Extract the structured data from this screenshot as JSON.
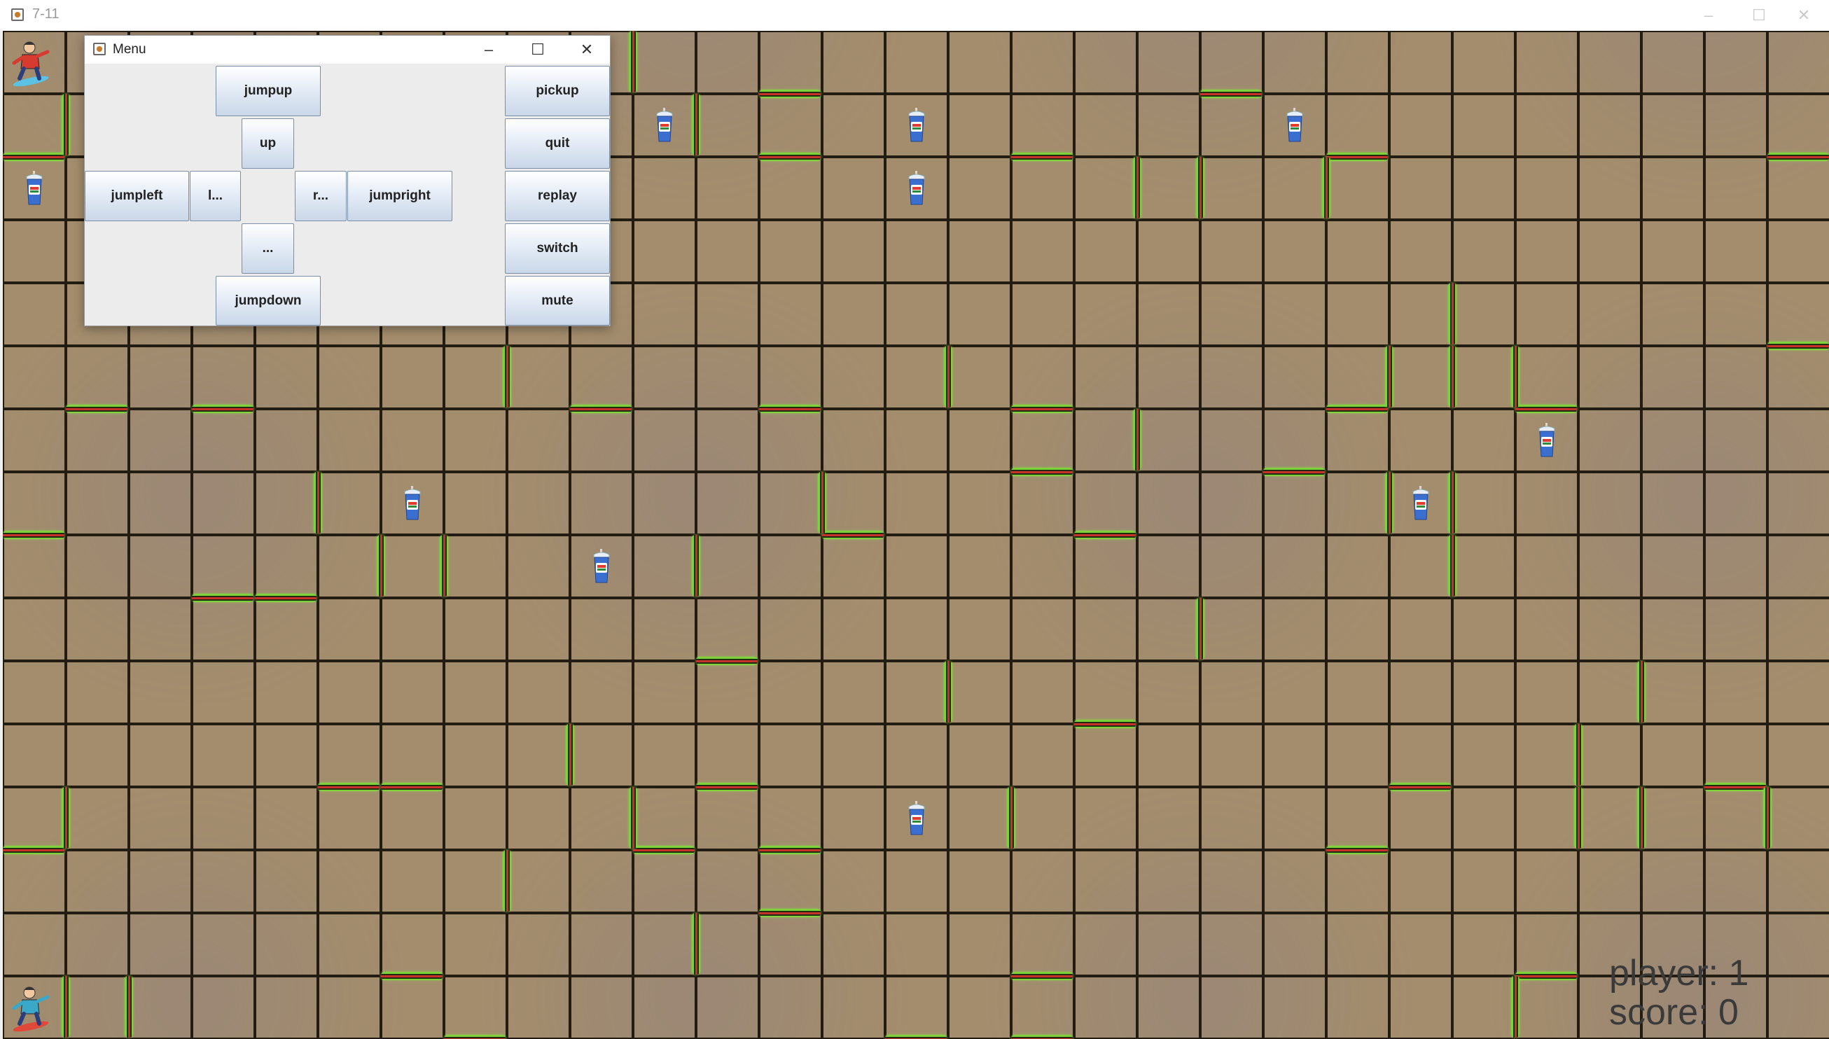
{
  "window": {
    "title": "7-11",
    "controls": [
      "minimize",
      "maximize",
      "close"
    ]
  },
  "menu": {
    "title": "Menu",
    "buttons": {
      "jumpup": "jumpup",
      "up": "up",
      "jumpleft": "jumpleft",
      "left": "l...",
      "right": "r...",
      "jumpright": "jumpright",
      "down": "...",
      "jumpdown": "jumpdown",
      "pickup": "pickup",
      "quit": "quit",
      "replay": "replay",
      "switch": "switch",
      "mute": "mute"
    }
  },
  "hud": {
    "player_label": "player: 1",
    "score_label": "score: 0"
  },
  "game": {
    "cell": 90,
    "walls_h": [
      [
        0,
        2
      ],
      [
        5,
        1
      ],
      [
        8,
        1
      ],
      [
        12,
        1
      ],
      [
        12,
        2
      ],
      [
        4,
        3
      ],
      [
        16,
        2
      ],
      [
        21,
        2
      ],
      [
        1,
        6
      ],
      [
        3,
        6
      ],
      [
        9,
        6
      ],
      [
        12,
        6
      ],
      [
        16,
        6
      ],
      [
        21,
        6
      ],
      [
        28,
        5
      ],
      [
        24,
        6
      ],
      [
        16,
        7
      ],
      [
        20,
        7
      ],
      [
        17,
        8
      ],
      [
        0,
        8
      ],
      [
        3,
        9
      ],
      [
        4,
        9
      ],
      [
        11,
        10
      ],
      [
        17,
        11
      ],
      [
        5,
        12
      ],
      [
        6,
        12
      ],
      [
        11,
        12
      ],
      [
        22,
        12
      ],
      [
        27,
        12
      ],
      [
        0,
        13
      ],
      [
        10,
        13
      ],
      [
        12,
        13
      ],
      [
        21,
        13
      ],
      [
        12,
        14
      ],
      [
        6,
        15
      ],
      [
        16,
        15
      ],
      [
        24,
        15
      ],
      [
        7,
        16
      ],
      [
        14,
        16
      ],
      [
        16,
        16
      ],
      [
        19,
        1
      ],
      [
        13,
        8
      ],
      [
        28,
        2
      ]
    ],
    "walls_v": [
      [
        1,
        1
      ],
      [
        10,
        0
      ],
      [
        11,
        1
      ],
      [
        18,
        2
      ],
      [
        19,
        2
      ],
      [
        21,
        2
      ],
      [
        8,
        5
      ],
      [
        15,
        5
      ],
      [
        18,
        6
      ],
      [
        23,
        4
      ],
      [
        23,
        5
      ],
      [
        24,
        5
      ],
      [
        22,
        5
      ],
      [
        5,
        7
      ],
      [
        6,
        8
      ],
      [
        7,
        8
      ],
      [
        11,
        8
      ],
      [
        13,
        7
      ],
      [
        22,
        7
      ],
      [
        23,
        7
      ],
      [
        23,
        8
      ],
      [
        19,
        9
      ],
      [
        15,
        10
      ],
      [
        26,
        10
      ],
      [
        9,
        11
      ],
      [
        1,
        12
      ],
      [
        10,
        12
      ],
      [
        16,
        12
      ],
      [
        25,
        11
      ],
      [
        25,
        12
      ],
      [
        26,
        12
      ],
      [
        28,
        12
      ],
      [
        8,
        13
      ],
      [
        11,
        14
      ],
      [
        1,
        15
      ],
      [
        2,
        15
      ],
      [
        24,
        15
      ]
    ],
    "cups": [
      [
        10,
        1
      ],
      [
        14,
        1
      ],
      [
        20,
        1
      ],
      [
        0,
        2
      ],
      [
        14,
        2
      ],
      [
        24,
        6
      ],
      [
        6,
        7
      ],
      [
        22,
        7
      ],
      [
        9,
        8
      ],
      [
        14,
        12
      ]
    ],
    "players": [
      [
        0,
        0
      ],
      [
        0,
        15
      ]
    ]
  }
}
